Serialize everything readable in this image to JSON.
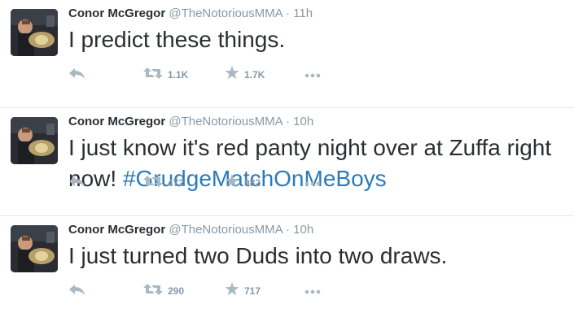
{
  "colors": {
    "name": "#292f33",
    "meta": "#8899a6",
    "hashtag": "#2b7bb9",
    "action_icon": "#aab8c2",
    "divider": "#e1e8ed"
  },
  "icons": {
    "reply": "reply-arrow-icon",
    "retweet": "retweet-icon",
    "favorite": "star-icon",
    "more": "more-dots-icon"
  },
  "tweets": [
    {
      "name": "Conor McGregor",
      "handle": "@TheNotoriousMMA",
      "separator": "·",
      "time": "11h",
      "text": "I predict these things.",
      "hashtag": "",
      "retweets": "1.1K",
      "favorites": "1.7K"
    },
    {
      "name": "Conor McGregor",
      "handle": "@TheNotoriousMMA",
      "separator": "·",
      "time": "10h",
      "text": "I just know it's red panty night over at Zuffa right now! ",
      "hashtag": "#GrudgeMatchOnMeBoys",
      "retweets": "472",
      "favorites": "982"
    },
    {
      "name": "Conor McGregor",
      "handle": "@TheNotoriousMMA",
      "separator": "·",
      "time": "10h",
      "text": "I just turned two Duds into two draws.",
      "hashtag": "",
      "retweets": "290",
      "favorites": "717"
    }
  ]
}
